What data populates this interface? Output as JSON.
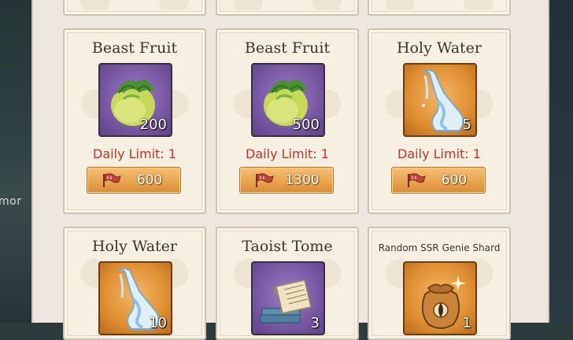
{
  "background": {
    "partial_text": "mor"
  },
  "shop": {
    "cards": [
      {
        "title": "Beast Fruit",
        "quantity": "200",
        "daily_limit": "Daily Limit: 1",
        "price": "600",
        "icon": "beast-fruit-icon",
        "frame": "purple"
      },
      {
        "title": "Beast Fruit",
        "quantity": "500",
        "daily_limit": "Daily Limit: 1",
        "price": "1300",
        "icon": "beast-fruit-icon",
        "frame": "purple"
      },
      {
        "title": "Holy Water",
        "quantity": "5",
        "daily_limit": "Daily Limit: 1",
        "price": "600",
        "icon": "holy-water-icon",
        "frame": "orange"
      },
      {
        "title": "Holy Water",
        "quantity": "10",
        "icon": "holy-water-icon",
        "frame": "orange"
      },
      {
        "title": "Taoist Tome",
        "quantity": "3",
        "icon": "tome-icon",
        "frame": "purple"
      },
      {
        "title": "Random SSR Genie Shard",
        "quantity": "1",
        "icon": "genie-shard-pouch-icon",
        "frame": "orange"
      }
    ],
    "currency_icon": "red-flag-currency-icon"
  },
  "colors": {
    "panel": "#ede7df",
    "limit_text": "#c5332a",
    "price_button": "#e7a24b",
    "purple_frame": "#7b5aa6",
    "orange_frame": "#e08f32"
  }
}
